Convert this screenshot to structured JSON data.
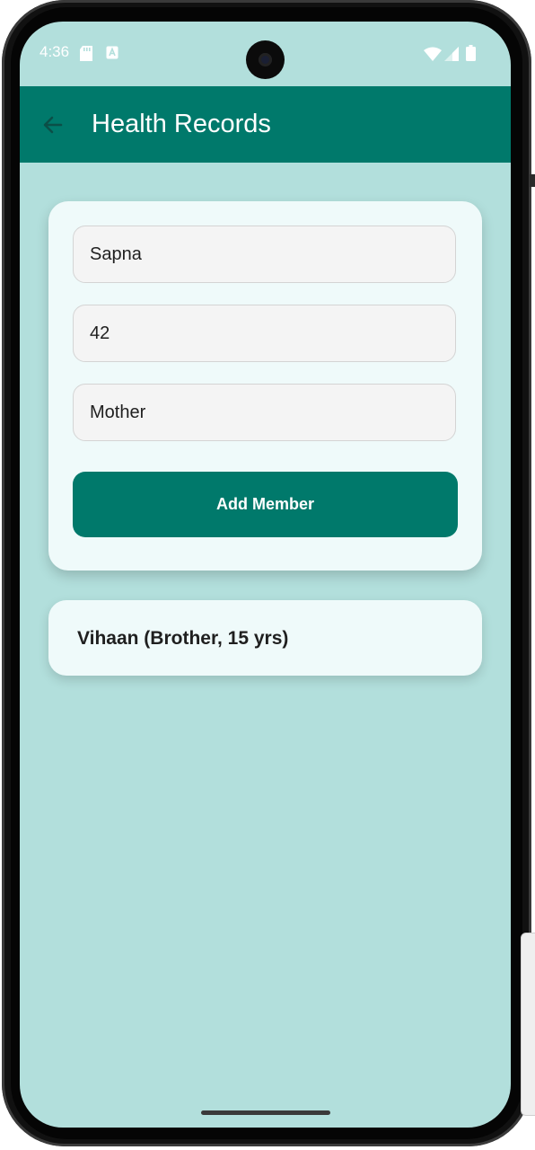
{
  "status_bar": {
    "time": "4:36",
    "icons": [
      "sd-card-icon",
      "a-badge-icon",
      "wifi-icon",
      "signal-icon",
      "battery-icon"
    ]
  },
  "app_bar": {
    "title": "Health Records",
    "back_icon": "arrow-back-icon"
  },
  "form": {
    "name_value": "Sapna",
    "age_value": "42",
    "relation_value": "Mother",
    "submit_label": "Add Member"
  },
  "members": [
    {
      "label": "Vihaan (Brother, 15 yrs)"
    }
  ],
  "colors": {
    "primary": "#00796b",
    "background": "#b2dfdc",
    "card": "#effafa",
    "field": "#f4f4f4"
  }
}
